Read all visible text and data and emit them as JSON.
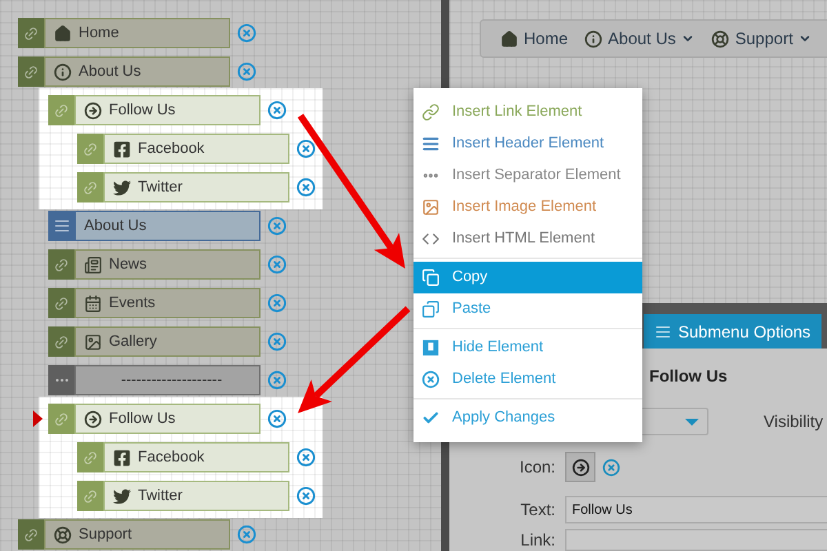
{
  "tree": [
    {
      "label": "Home",
      "kind": "link",
      "highlighted": false,
      "marker": false
    },
    {
      "label": "About Us",
      "kind": "link",
      "highlighted": false,
      "marker": false,
      "children": [
        {
          "label": "Follow Us",
          "kind": "link",
          "highlighted": true,
          "marker": false,
          "children": [
            {
              "label": "Facebook",
              "kind": "link",
              "highlighted": true,
              "marker": false
            },
            {
              "label": "Twitter",
              "kind": "link",
              "highlighted": true,
              "marker": false
            }
          ]
        },
        {
          "label": "About Us",
          "kind": "header",
          "highlighted": false,
          "marker": false
        },
        {
          "label": "News",
          "kind": "link",
          "highlighted": false,
          "marker": false
        },
        {
          "label": "Events",
          "kind": "link",
          "highlighted": false,
          "marker": false
        },
        {
          "label": "Gallery",
          "kind": "link",
          "highlighted": false,
          "marker": false
        },
        {
          "label": "--------------------",
          "kind": "separator",
          "highlighted": false,
          "marker": false
        },
        {
          "label": "Follow Us",
          "kind": "link",
          "highlighted": true,
          "marker": true,
          "children": [
            {
              "label": "Facebook",
              "kind": "link",
              "highlighted": true,
              "marker": false
            },
            {
              "label": "Twitter",
              "kind": "link",
              "highlighted": true,
              "marker": false
            }
          ]
        }
      ]
    },
    {
      "label": "Support",
      "kind": "link",
      "highlighted": false,
      "marker": false
    }
  ],
  "preview_nav": [
    {
      "label": "Home",
      "dropdown": false
    },
    {
      "label": "About Us",
      "dropdown": true
    },
    {
      "label": "Support",
      "dropdown": true
    }
  ],
  "tabs": [
    {
      "label": "Submenu Options",
      "selected": true
    }
  ],
  "form": {
    "heading": "Follow Us",
    "visibility_label": "Visibility",
    "icon_label": "Icon:",
    "text_label": "Text:",
    "text_value": "Follow Us",
    "link_label": "Link:"
  },
  "context_menu": [
    [
      {
        "label": "Insert Link Element",
        "kind": "link",
        "color": "#8aa85a",
        "selected": false
      },
      {
        "label": "Insert Header Element",
        "kind": "header",
        "color": "#4a88c0",
        "selected": false
      },
      {
        "label": "Insert Separator Element",
        "kind": "separator",
        "color": "#888888",
        "selected": false
      },
      {
        "label": "Insert Image Element",
        "kind": "image",
        "color": "#d08a50",
        "selected": false
      },
      {
        "label": "Insert HTML Element",
        "kind": "html",
        "color": "#777777",
        "selected": false
      }
    ],
    [
      {
        "label": "Copy",
        "kind": "copy",
        "color": "#0a9bd6",
        "selected": true
      },
      {
        "label": "Paste",
        "kind": "paste",
        "color": "#2a9fd6",
        "selected": false
      }
    ],
    [
      {
        "label": "Hide Element",
        "kind": "hide",
        "color": "#2a9fd6",
        "selected": false
      },
      {
        "label": "Delete Element",
        "kind": "delete",
        "color": "#2a9fd6",
        "selected": false
      }
    ],
    [
      {
        "label": "Apply Changes",
        "kind": "apply",
        "color": "#2a9fd6",
        "selected": false
      }
    ]
  ]
}
